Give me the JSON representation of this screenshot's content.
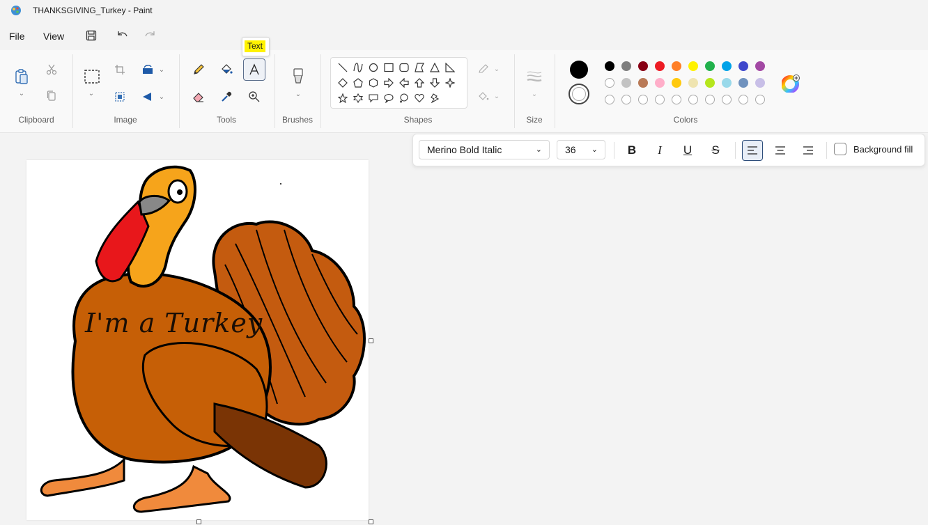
{
  "window": {
    "title": "THANKSGIVING_Turkey - Paint"
  },
  "menu": {
    "file": "File",
    "view": "View"
  },
  "ribbon": {
    "groups": {
      "clipboard": "Clipboard",
      "image": "Image",
      "tools": "Tools",
      "brushes": "Brushes",
      "shapes": "Shapes",
      "size": "Size",
      "colors": "Colors"
    },
    "tooltip": "Text"
  },
  "palette": {
    "primary": "#000000",
    "secondary": "#ffffff",
    "row1": [
      "#000000",
      "#7f7f7f",
      "#880015",
      "#ed1c24",
      "#ff7f27",
      "#fff200",
      "#22b14c",
      "#00a2e8",
      "#3f48cc",
      "#a349a4"
    ],
    "row2": [
      "empty",
      "#c3c3c3",
      "#b97a57",
      "#ffaec9",
      "#ffc90e",
      "#efe4b0",
      "#b5e61d",
      "#99d9ea",
      "#7092be",
      "#c8bfe7"
    ]
  },
  "text_toolbar": {
    "font": "Merino Bold Italic",
    "size": "36",
    "bold": "B",
    "italic": "I",
    "underline": "U",
    "strike": "S",
    "background_fill": "Background fill"
  },
  "canvas": {
    "caption": "I'm a Turkey"
  }
}
